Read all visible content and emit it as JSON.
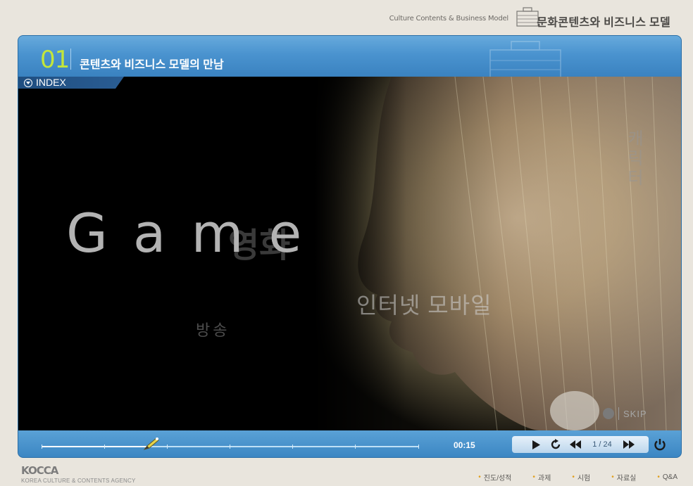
{
  "header": {
    "english_title": "Culture Contents & Business Model",
    "korean_title": "문화콘텐츠와 비즈니스 모델",
    "briefcase_icon": "briefcase-icon"
  },
  "chapter": {
    "number": "01",
    "title": "콘텐츠와 비즈니스 모델의 만남"
  },
  "index": {
    "label": "INDEX",
    "icon": "dropdown-circle-icon"
  },
  "video": {
    "words": {
      "game": "Game",
      "movie": "영화",
      "broadcast": "방송",
      "internet_mobile": "인터넷 모바일",
      "character": "캐릭터"
    },
    "skip_label": "SKIP"
  },
  "controls": {
    "time": "00:15",
    "progress": 0.28,
    "page_indicator": "1 / 24",
    "icons": [
      "play-icon",
      "replay-icon",
      "previous-icon",
      "next-icon",
      "power-icon"
    ]
  },
  "footer": {
    "logo": "KOCCA",
    "logo_sub": "KOREA CULTURE & CONTENTS AGENCY",
    "nav": [
      "진도/성적",
      "과제",
      "시험",
      "자료실",
      "Q&A"
    ]
  },
  "colors": {
    "accent_blue": "#3a87c3",
    "chapter_number": "#c3e63a",
    "bullet": "#e0a020"
  }
}
